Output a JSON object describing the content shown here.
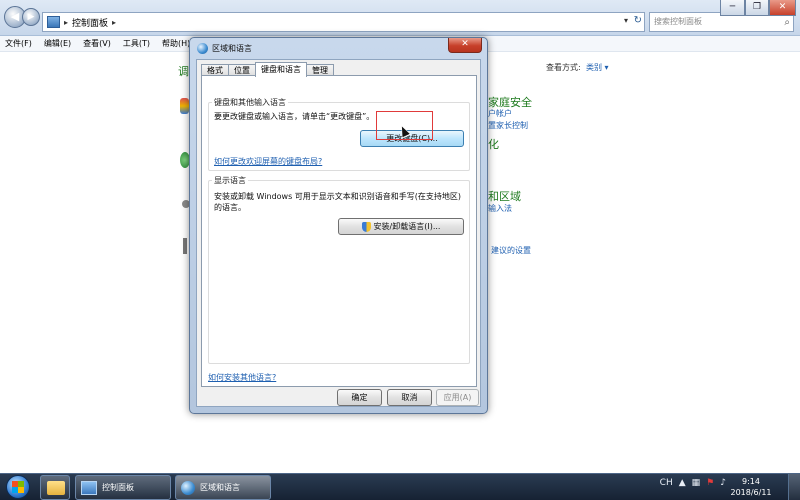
{
  "control_panel": {
    "address": {
      "crumb": "控制面板",
      "sep": "▸"
    },
    "search_placeholder": "搜索控制面板",
    "menu": [
      "文件(F)",
      "编辑(E)",
      "查看(V)",
      "工具(T)",
      "帮助(H)"
    ],
    "view_as_label": "查看方式:",
    "view_as_value": "类别 ▾",
    "left_fragment": "调",
    "headings": [
      "家庭安全",
      "化",
      "和区域"
    ],
    "links": [
      "户帐户",
      "置家长控制",
      "输入法",
      "建议的设置"
    ]
  },
  "dialog": {
    "title": "区域和语言",
    "close": "✕",
    "tabs": [
      "格式",
      "位置",
      "键盘和语言",
      "管理"
    ],
    "active_tab": 2,
    "keyboard_group": {
      "title": "键盘和其他输入语言",
      "desc": "要更改键盘或输入语言，请单击“更改键盘”。",
      "button": "更改键盘(C)...",
      "link": "如何更改欢迎屏幕的键盘布局?"
    },
    "display_group": {
      "title": "显示语言",
      "desc": "安装或卸载 Windows 可用于显示文本和识别语音和手写(在支持地区)的语言。",
      "button": "安装/卸载语言(I)..."
    },
    "bottom_link": "如何安装其他语言?",
    "buttons": {
      "ok": "确定",
      "cancel": "取消",
      "apply": "应用(A)"
    }
  },
  "taskbar": {
    "items": [
      "控制面板",
      "区域和语言"
    ],
    "time": "9:14",
    "date": "2018/6/11",
    "lang": "CH"
  }
}
